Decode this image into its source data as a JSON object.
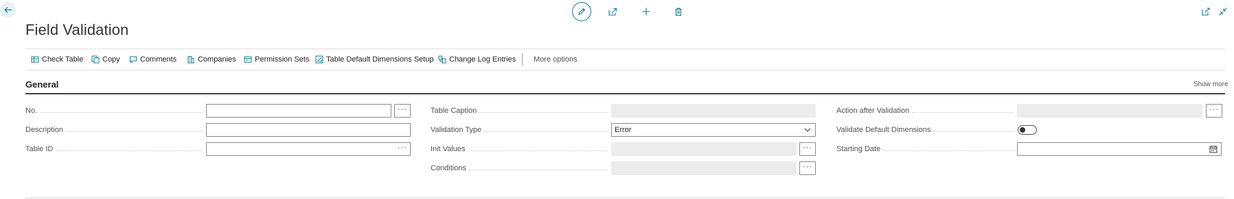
{
  "header": {
    "title": "Field Validation"
  },
  "actions": {
    "items": [
      {
        "id": "check-table",
        "label": "Check Table",
        "icon": "table-check-icon"
      },
      {
        "id": "copy",
        "label": "Copy",
        "icon": "copy-icon"
      },
      {
        "id": "comments",
        "label": "Comments",
        "icon": "comment-icon"
      },
      {
        "id": "companies",
        "label": "Companies",
        "icon": "building-icon"
      },
      {
        "id": "permission-sets",
        "label": "Permission Sets",
        "icon": "permission-icon"
      },
      {
        "id": "table-default-dimensions",
        "label": "Table Default Dimensions Setup",
        "icon": "dimensions-icon"
      },
      {
        "id": "change-log",
        "label": "Change Log Entries",
        "icon": "log-icon"
      }
    ],
    "more_options": "More options"
  },
  "section": {
    "title": "General",
    "show_more": "Show more"
  },
  "fields": {
    "no": {
      "label": "No.",
      "value": ""
    },
    "description": {
      "label": "Description",
      "value": ""
    },
    "table_id": {
      "label": "Table ID",
      "value": ""
    },
    "table_caption": {
      "label": "Table Caption",
      "value": ""
    },
    "validation_type": {
      "label": "Validation Type",
      "value": "Error"
    },
    "init_values": {
      "label": "Init Values",
      "value": ""
    },
    "conditions": {
      "label": "Conditions",
      "value": ""
    },
    "action_after_validation": {
      "label": "Action after Validation",
      "value": ""
    },
    "validate_default_dimensions": {
      "label": "Validate Default Dimensions",
      "value": false
    },
    "starting_date": {
      "label": "Starting Date",
      "value": ""
    }
  },
  "ellipsis": "···",
  "colors": {
    "accent": "#0a7f8a",
    "section_line": "#3c3f64",
    "readonly_bg": "#ececec"
  }
}
